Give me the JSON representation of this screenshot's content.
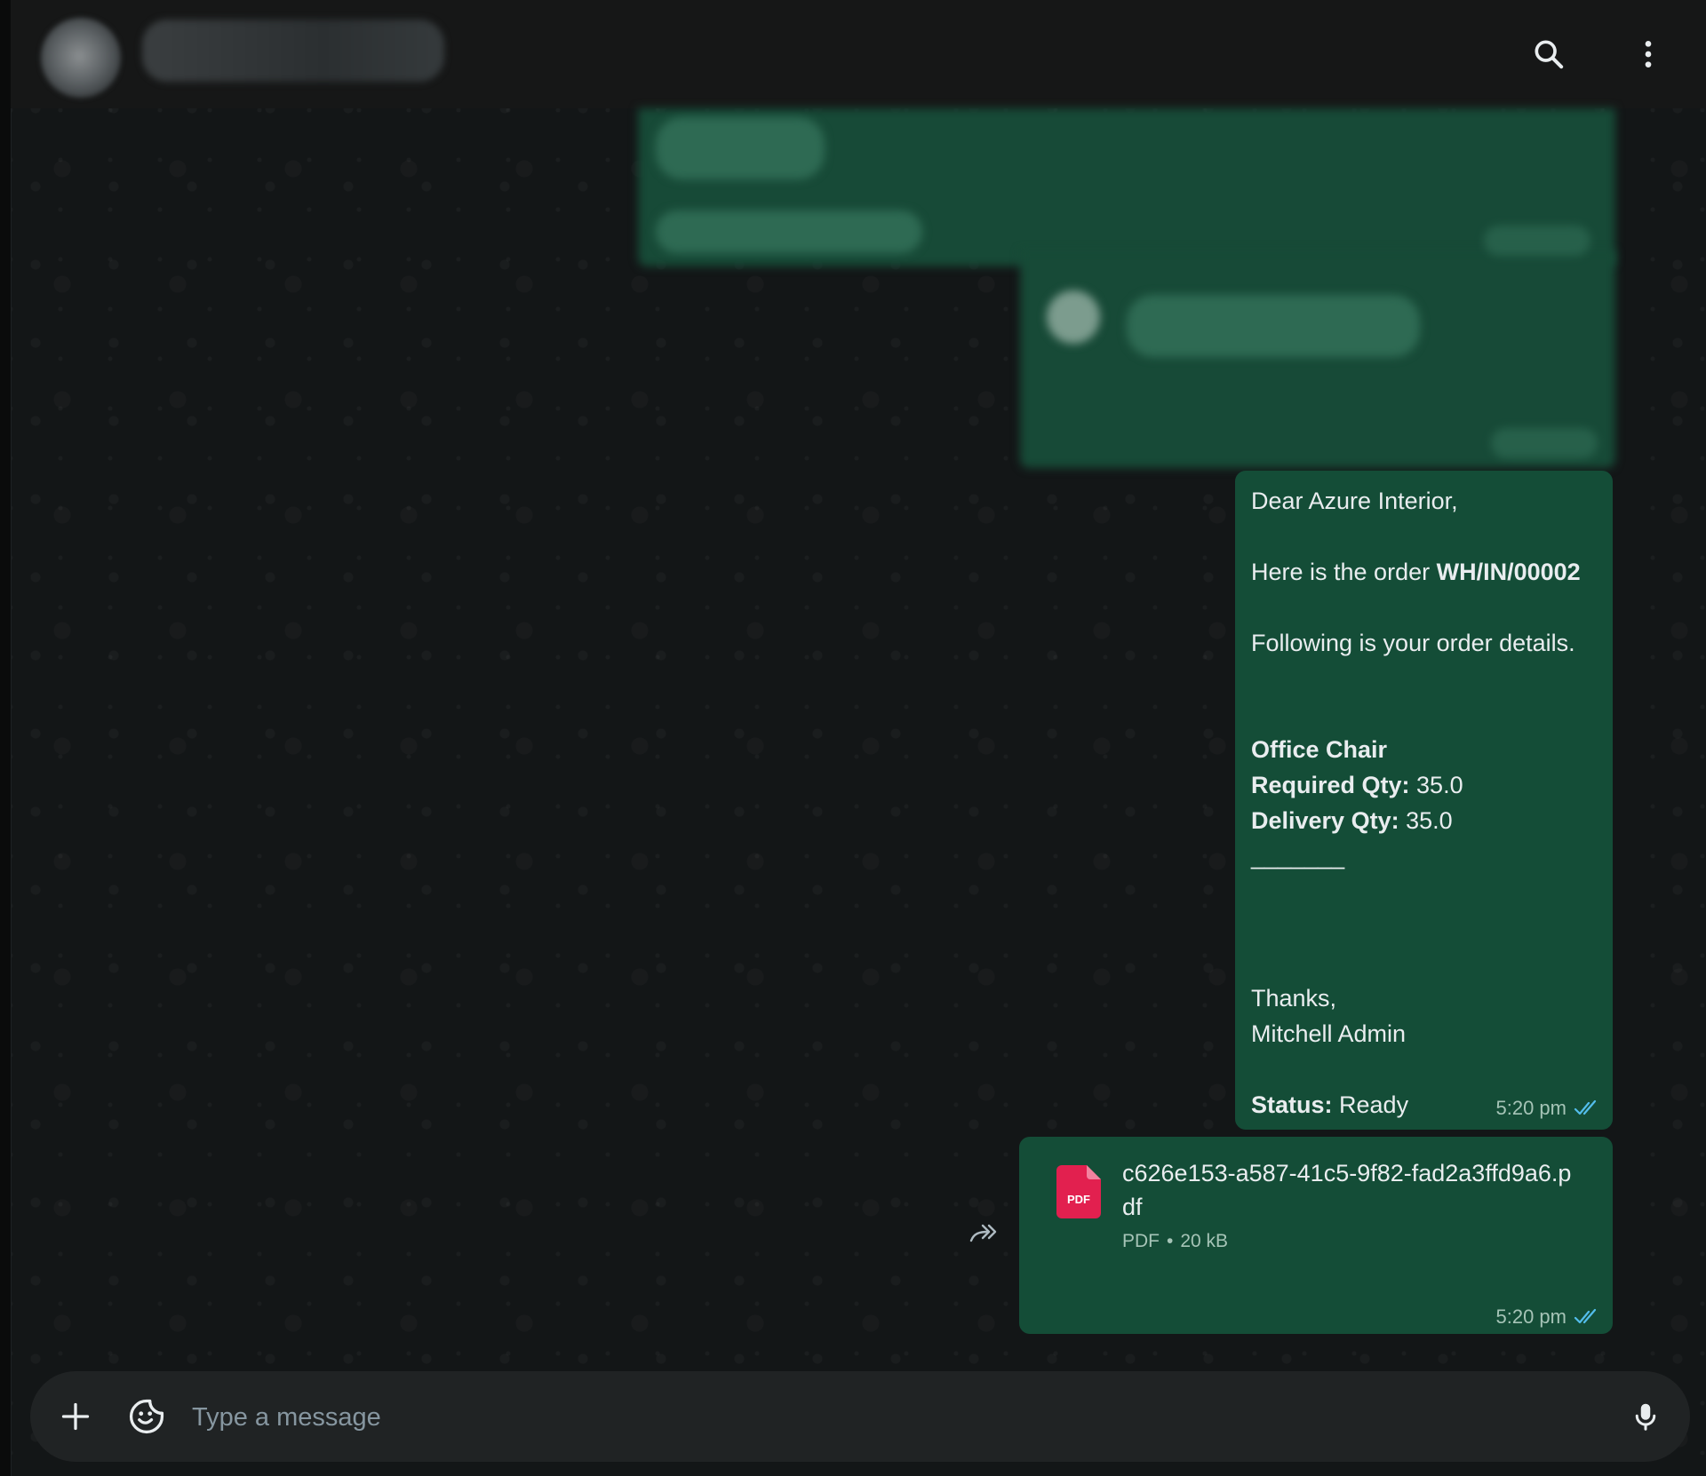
{
  "header": {
    "contact_name": "",
    "icons": {
      "search": "search-icon",
      "menu": "more-vertical-icon"
    }
  },
  "messages": [
    {
      "id": "order-message",
      "type": "text",
      "greeting": "Dear Azure Interior,",
      "intro_prefix": "Here is the order ",
      "order_ref": "WH/IN/00002",
      "details_intro": "Following is your order details.",
      "product_name": "Office Chair",
      "required_label": "Required Qty:",
      "required_value": " 35.0",
      "delivery_label": "Delivery Qty:",
      "delivery_value": " 35.0",
      "separator": "_______",
      "closing": "Thanks,",
      "signature": "Mitchell Admin",
      "status_label": "Status:",
      "status_value": " Ready",
      "time": "5:20 pm",
      "read_receipt": "double-check-icon"
    },
    {
      "id": "pdf-message",
      "type": "document",
      "file_badge": "PDF",
      "file_name": "c626e153-a587-41c5-9f82-fad2a3ffd9a6.pdf",
      "file_type": "PDF",
      "file_separator": "•",
      "file_size": "20 kB",
      "time": "5:20 pm",
      "read_receipt": "double-check-icon"
    }
  ],
  "composer": {
    "placeholder": "Type a message",
    "value": "",
    "icons": {
      "attach": "plus-icon",
      "sticker": "sticker-icon",
      "voice": "mic-icon"
    }
  },
  "colors": {
    "outgoing_bubble": "#144d37",
    "read_receipt": "#53bdeb",
    "background": "#131617",
    "header": "#161717",
    "composer": "#202324",
    "pdf_red": "#e2204f"
  }
}
